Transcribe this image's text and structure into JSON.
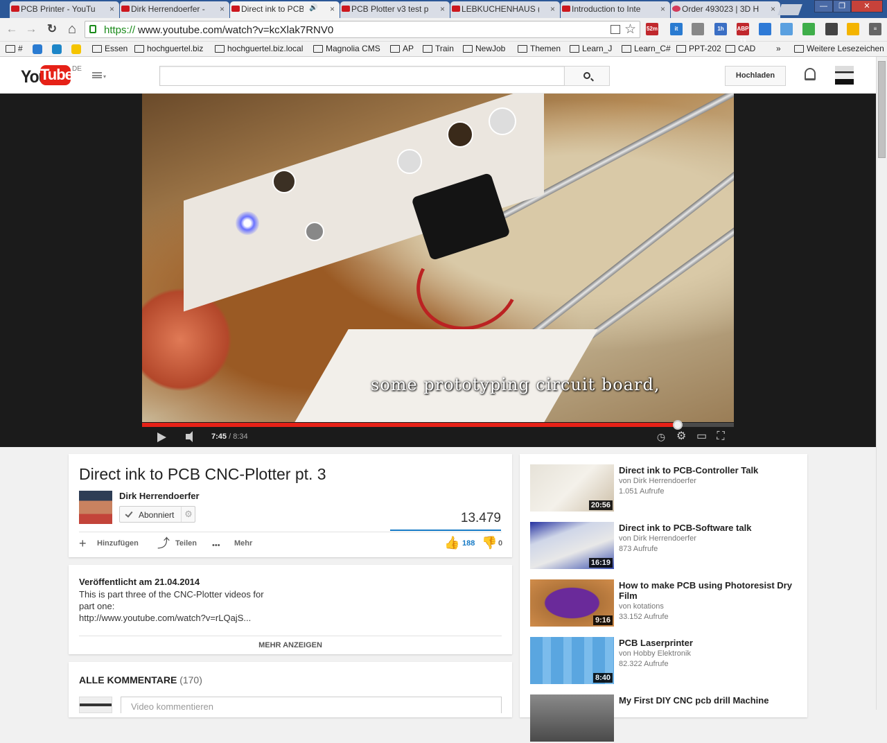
{
  "browser": {
    "tabs": [
      {
        "title": "PCB Printer - YouTu",
        "icon": "youtube-favicon"
      },
      {
        "title": "Dirk Herrendoerfer -",
        "icon": "youtube-favicon"
      },
      {
        "title": "Direct ink to PCB",
        "icon": "youtube-favicon",
        "active": true,
        "audio": "🔊"
      },
      {
        "title": "PCB Plotter v3 test p",
        "icon": "youtube-favicon"
      },
      {
        "title": "LEBKUCHENHAUS (",
        "icon": "youtube-favicon"
      },
      {
        "title": "Introduction to Inte",
        "icon": "youtube-favicon"
      },
      {
        "title": "Order 493023 | 3D H",
        "icon": "3dhubs-favicon"
      }
    ],
    "close_glyph": "×",
    "window_buttons": [
      "—",
      "❐",
      "✕"
    ],
    "url_scheme": "https://",
    "url_rest": "www.youtube.com/watch?v=kcXlak7RNV0",
    "nav_glyphs": {
      "back": "←",
      "forward": "→",
      "reload": "↻",
      "home": "⌂",
      "star": "☆"
    },
    "extensions": [
      {
        "label": "52m",
        "color": "#c0282d"
      },
      {
        "label": "it",
        "color": "#2a7bd1"
      },
      {
        "label": "",
        "color": "#888888"
      },
      {
        "label": "1h",
        "color": "#3b6fc4"
      },
      {
        "label": "ABP 13",
        "color": "#c0282d"
      },
      {
        "label": "",
        "color": "#2f7ad6"
      },
      {
        "label": "",
        "color": "#5aa0e0"
      },
      {
        "label": "",
        "color": "#3fae4a"
      },
      {
        "label": "",
        "color": "#444444"
      },
      {
        "label": "",
        "color": "#f4b400"
      },
      {
        "label": "≡",
        "color": "#666666"
      }
    ],
    "bookmarks": [
      {
        "label": "#",
        "kind": "folder"
      },
      {
        "label": "",
        "kind": "app",
        "color": "#2a7bd1"
      },
      {
        "label": "",
        "kind": "app",
        "color": "#1d86c8"
      },
      {
        "label": "",
        "kind": "app",
        "color": "#f5c400"
      },
      {
        "label": "Essen",
        "kind": "folder"
      },
      {
        "label": "hochguertel.biz",
        "kind": "folder"
      },
      {
        "label": "hochguertel.biz.local",
        "kind": "folder"
      },
      {
        "label": "Magnolia CMS",
        "kind": "folder"
      },
      {
        "label": "AP",
        "kind": "folder"
      },
      {
        "label": "Train",
        "kind": "folder"
      },
      {
        "label": "NewJob",
        "kind": "folder"
      },
      {
        "label": "Themen",
        "kind": "folder"
      },
      {
        "label": "Learn_J",
        "kind": "folder"
      },
      {
        "label": "Learn_C#",
        "kind": "folder"
      },
      {
        "label": "PPT-202",
        "kind": "folder"
      },
      {
        "label": "CAD",
        "kind": "folder"
      }
    ],
    "bookmarks_overflow": "»",
    "other_bookmarks": "Weitere Lesezeichen"
  },
  "header": {
    "logo_you": "You",
    "logo_tube": "Tube",
    "logo_region": "DE",
    "search_placeholder": "",
    "upload_label": "Hochladen",
    "caret": "▾"
  },
  "player": {
    "caption": "some prototyping circuit board,",
    "current_time": "7:45",
    "duration": "/ 8:34",
    "progress_fraction": 0.9047,
    "icons": [
      "play-icon",
      "volume-icon",
      "watch-later-icon",
      "settings-icon",
      "theater-icon",
      "fullscreen-icon"
    ],
    "glyphs": {
      "watch_later": "◷",
      "settings": "⚙",
      "theater": "▭",
      "fullscreen": "⛶"
    }
  },
  "video": {
    "title": "Direct ink to PCB CNC-Plotter pt. 3",
    "channel": "Dirk Herrendoerfer",
    "subscribe_label": "Abonniert",
    "subscribe_gear": "⚙",
    "views": "13.479",
    "actions": [
      {
        "label": "Hinzufügen",
        "glyph": "+"
      },
      {
        "label": "Teilen",
        "glyph": "⤴"
      },
      {
        "label": "Mehr",
        "glyph": "•••"
      }
    ],
    "likes": "188",
    "dislikes": "0",
    "like_glyph": "👍",
    "dislike_glyph": "👎"
  },
  "description": {
    "published": "Veröffentlicht am 21.04.2014",
    "lines": [
      "This is part three of the CNC-Plotter videos for",
      "part one:",
      "http://www.youtube.com/watch?v=rLQajS..."
    ],
    "show_more": "MEHR ANZEIGEN"
  },
  "comments": {
    "title": "ALLE KOMMENTARE",
    "count": "(170)",
    "input_placeholder": "Video kommentieren"
  },
  "related": [
    {
      "title": "Direct ink to PCB-Controller Talk",
      "channel": "von Dirk Herrendoerfer",
      "views": "1.051 Aufrufe",
      "duration": "20:56",
      "theme": "paper"
    },
    {
      "title": "Direct ink to PCB-Software talk",
      "channel": "von Dirk Herrendoerfer",
      "views": "873 Aufrufe",
      "duration": "16:19",
      "theme": "screen"
    },
    {
      "title": "How to make PCB using Photoresist Dry Film",
      "channel": "von kotations",
      "views": "33.152 Aufrufe",
      "duration": "9:16",
      "theme": "purple"
    },
    {
      "title": "PCB Laserprinter",
      "channel": "von Hobby Elektronik",
      "views": "82.322 Aufrufe",
      "duration": "8:40",
      "theme": "drills"
    },
    {
      "title": "My First DIY CNC pcb drill Machine",
      "channel": "",
      "views": "",
      "duration": "",
      "theme": "cnc"
    }
  ],
  "colors": {
    "youtube_red": "#e62117",
    "link_blue": "#167ac6",
    "tab_strip": "#2b5797"
  }
}
